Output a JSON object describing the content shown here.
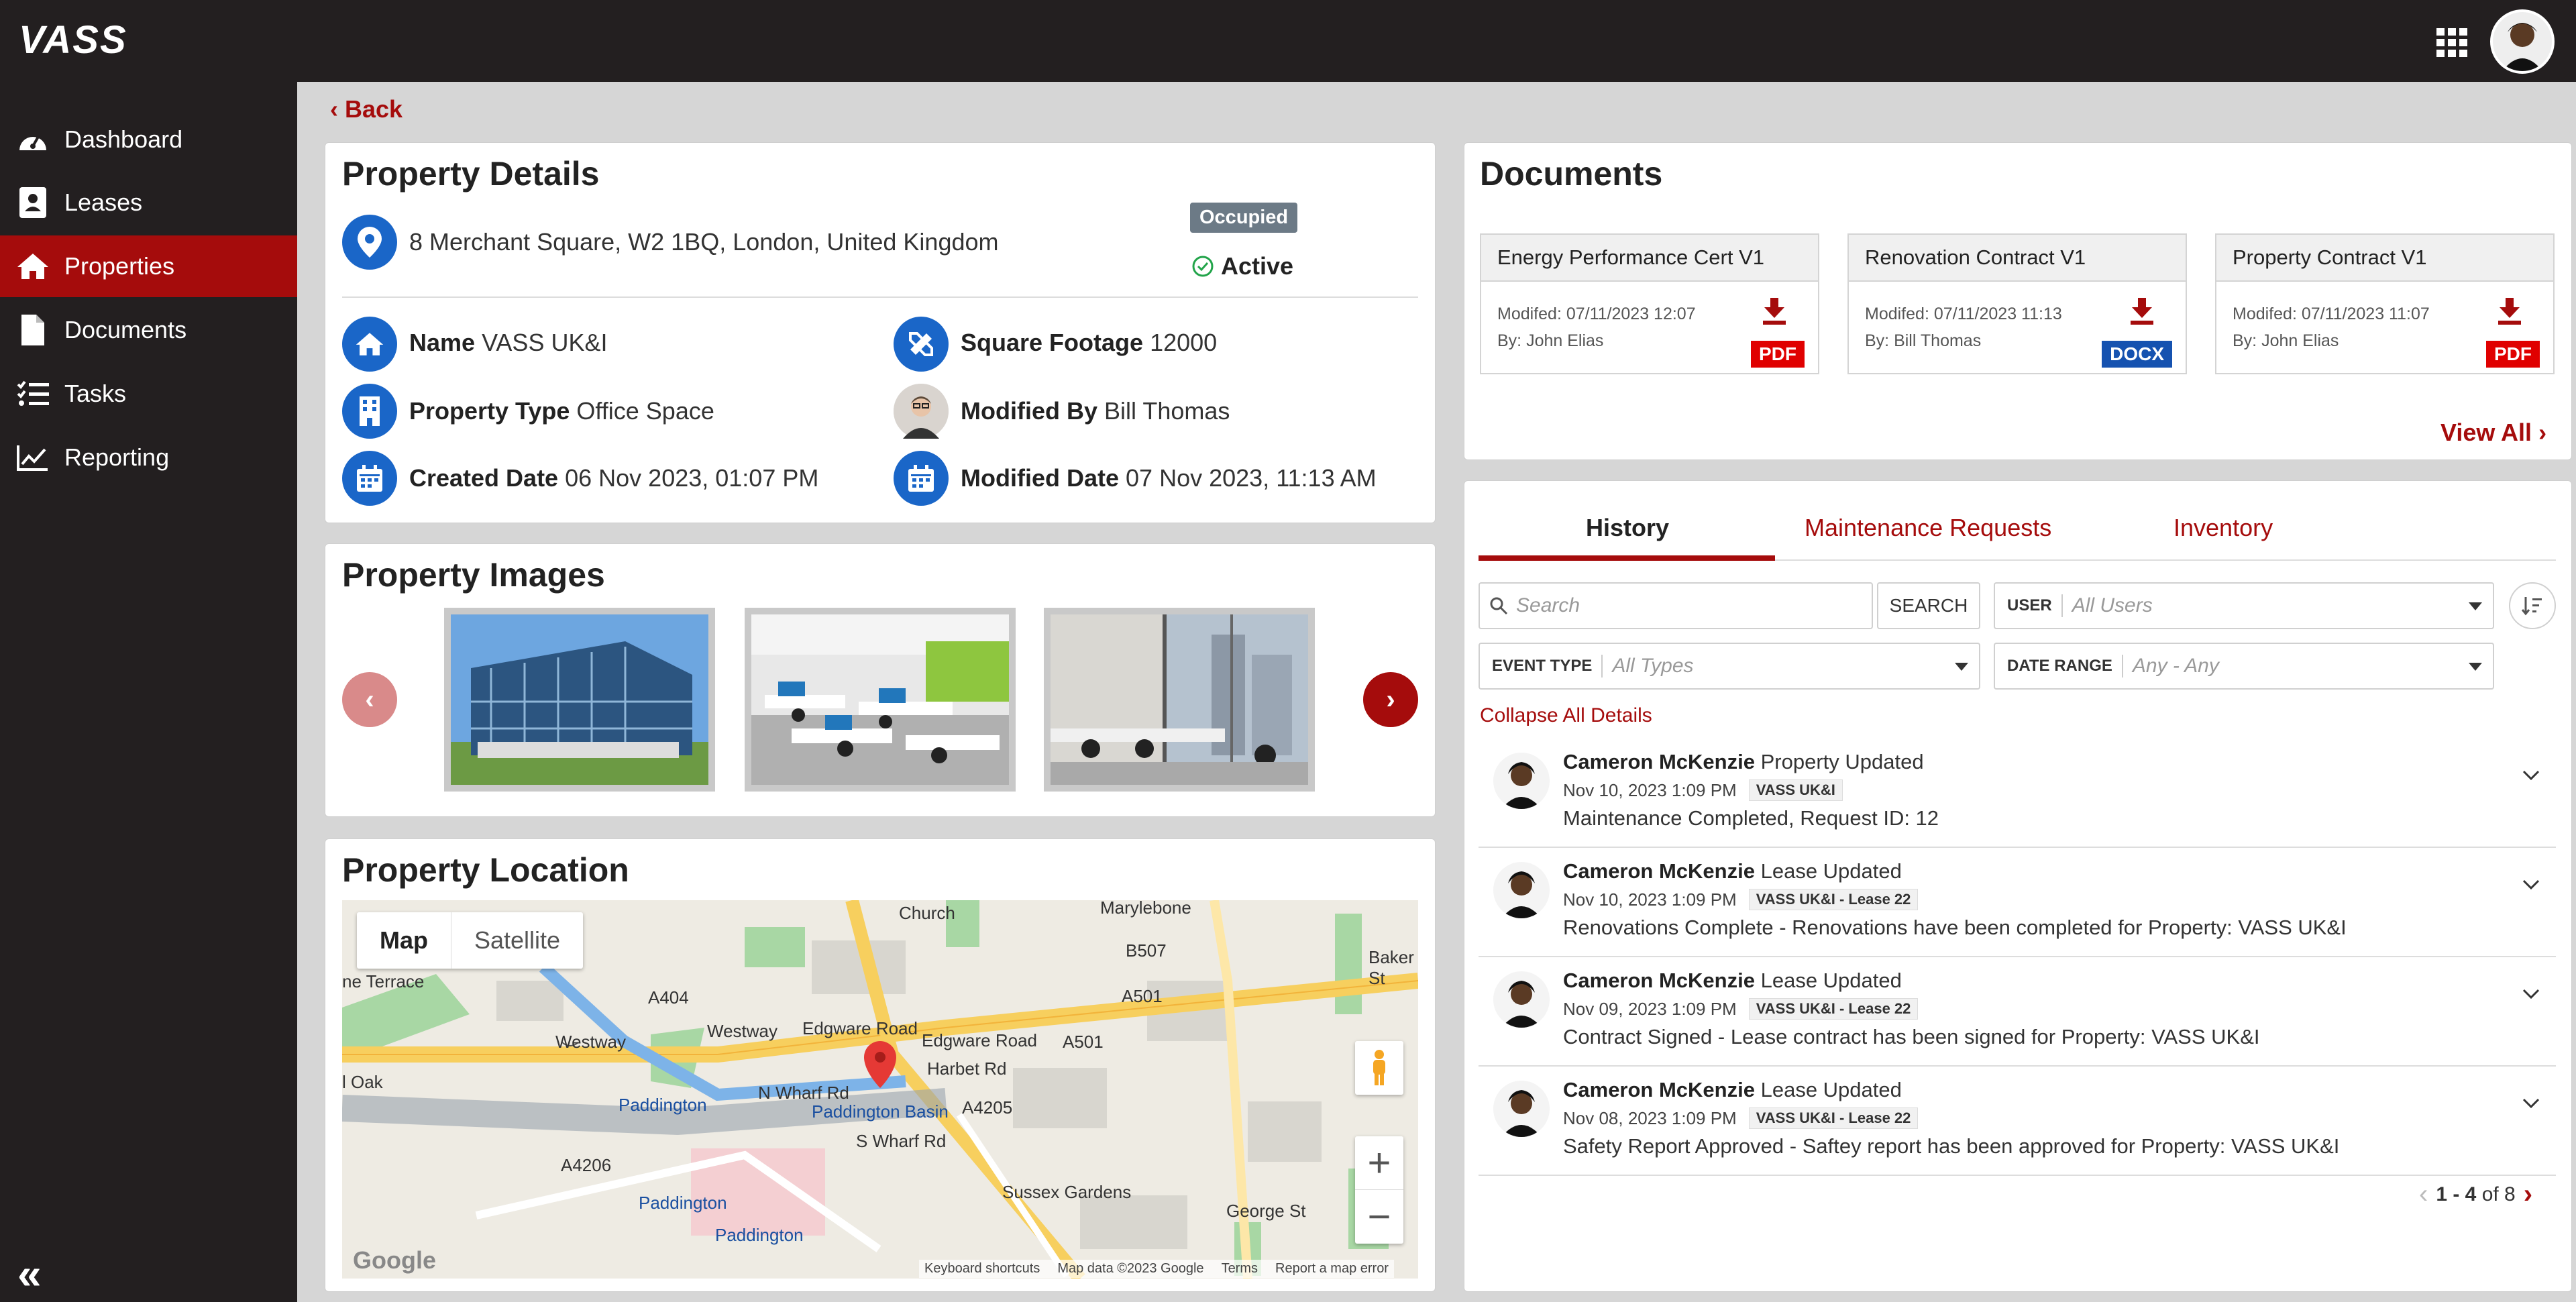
{
  "app": {
    "logo": "VASS"
  },
  "sidebar": {
    "items": [
      {
        "label": "Dashboard",
        "icon": "dashboard-icon"
      },
      {
        "label": "Leases",
        "icon": "lease-icon"
      },
      {
        "label": "Properties",
        "icon": "home-icon"
      },
      {
        "label": "Documents",
        "icon": "document-icon"
      },
      {
        "label": "Tasks",
        "icon": "tasks-icon"
      },
      {
        "label": "Reporting",
        "icon": "chart-icon"
      }
    ],
    "collapse": "«"
  },
  "back": {
    "label": "Back"
  },
  "property_details": {
    "title": "Property Details",
    "address": "8 Merchant Square, W2 1BQ, London, United Kingdom",
    "occupancy": "Occupied",
    "status": "Active",
    "fields": {
      "name_label": "Name",
      "name_value": "VASS UK&I",
      "sqft_label": "Square Footage",
      "sqft_value": "12000",
      "type_label": "Property Type",
      "type_value": "Office Space",
      "modby_label": "Modified By",
      "modby_value": "Bill Thomas",
      "created_label": "Created Date",
      "created_value": "06 Nov 2023, 01:07 PM",
      "modified_label": "Modified Date",
      "modified_value": "07 Nov 2023, 11:13 AM"
    }
  },
  "property_images": {
    "title": "Property Images"
  },
  "property_location": {
    "title": "Property Location",
    "map_tab": "Map",
    "satellite_tab": "Satellite",
    "labels": {
      "edgware1": "Edgware Road",
      "edgware2": "Edgware Road",
      "westway1": "Westway",
      "westway2": "Westway",
      "a501": "A501",
      "a404": "A404",
      "a4206": "A4206",
      "a4205": "A4205",
      "paddington1": "Paddington",
      "paddington2": "Paddington",
      "paddington3": "Paddington",
      "basin": "Paddington Basin",
      "harbet": "Harbet Rd",
      "wharf": "N Wharf Rd",
      "swharf": "S Wharf Rd",
      "sussex": "Sussex Gardens",
      "george": "George St",
      "baker": "Baker St",
      "marylebone": "Marylebone",
      "church": "Church",
      "oak": "l Oak",
      "terrace": "ne Terrace",
      "b507": "B507"
    },
    "footer": {
      "google": "Google",
      "shortcuts": "Keyboard shortcuts",
      "mapdata": "Map data ©2023 Google",
      "terms": "Terms",
      "report": "Report a map error"
    }
  },
  "documents": {
    "title": "Documents",
    "items": [
      {
        "name": "Energy Performance Cert V1",
        "modified": "Modifed: 07/11/2023 12:07",
        "by": "By: John Elias",
        "type": "PDF",
        "color": "#e00000"
      },
      {
        "name": "Renovation Contract V1",
        "modified": "Modifed: 07/11/2023 11:13",
        "by": "By: Bill Thomas",
        "type": "DOCX",
        "color": "#1552b0"
      },
      {
        "name": "Property Contract V1",
        "modified": "Modifed: 07/11/2023 11:07",
        "by": "By: John Elias",
        "type": "PDF",
        "color": "#e00000"
      }
    ],
    "view_all": "View All"
  },
  "history": {
    "tabs": [
      "History",
      "Maintenance Requests",
      "Inventory"
    ],
    "search_placeholder": "Search",
    "search_button": "SEARCH",
    "user_label": "USER",
    "user_value": "All Users",
    "event_label": "EVENT TYPE",
    "event_value": "All Types",
    "date_label": "DATE RANGE",
    "date_value": "Any - Any",
    "collapse_all": "Collapse All Details",
    "items": [
      {
        "user": "Cameron McKenzie",
        "action": "Property Updated",
        "date": "Nov 10, 2023 1:09 PM",
        "tag": "VASS UK&I",
        "desc": "Maintenance Completed, Request ID: 12"
      },
      {
        "user": "Cameron McKenzie",
        "action": "Lease Updated",
        "date": "Nov 10, 2023 1:09 PM",
        "tag": "VASS UK&I - Lease 22",
        "desc": "Renovations Complete - Renovations have been completed for Property: VASS UK&I"
      },
      {
        "user": "Cameron McKenzie",
        "action": "Lease Updated",
        "date": "Nov 09, 2023 1:09 PM",
        "tag": "VASS UK&I - Lease 22",
        "desc": "Contract Signed - Lease contract has been signed for Property: VASS UK&I"
      },
      {
        "user": "Cameron McKenzie",
        "action": "Lease Updated",
        "date": "Nov 08, 2023 1:09 PM",
        "tag": "VASS UK&I - Lease 22",
        "desc": "Safety Report Approved - Saftey report has been approved for Property: VASS UK&I"
      }
    ],
    "pager": {
      "range": "1 - 4",
      "of": "of 8"
    }
  },
  "colors": {
    "accent": "#a50c0c",
    "blue": "#1a66c8",
    "dark": "#231f20"
  }
}
